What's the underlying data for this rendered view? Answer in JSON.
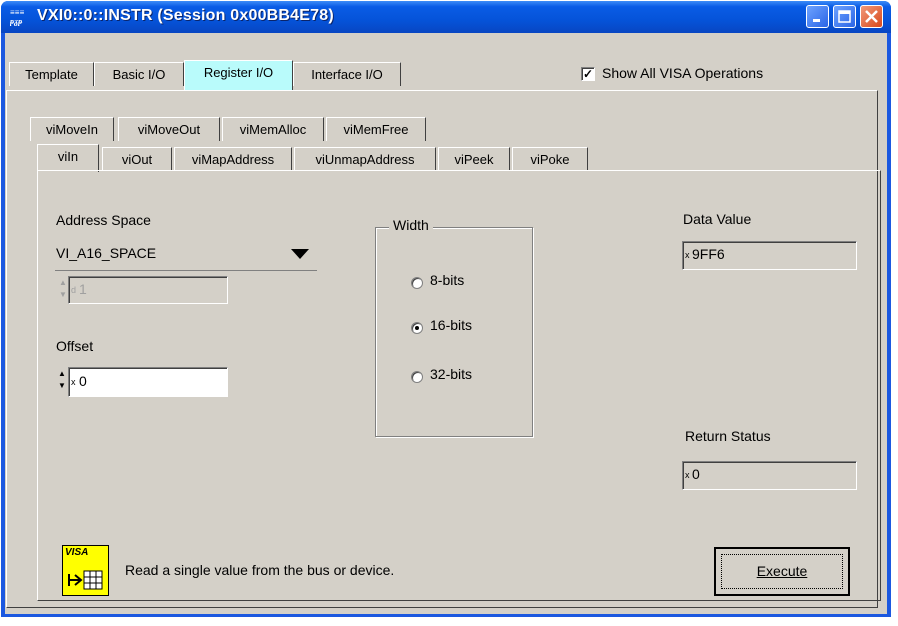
{
  "window": {
    "title": "VXI0::0::INSTR (Session 0x00BB4E78)"
  },
  "tabs": {
    "top": [
      "Template",
      "Basic I/O",
      "Register I/O",
      "Interface I/O"
    ],
    "active_top": "Register I/O",
    "sub_row1": [
      "viMoveIn",
      "viMoveOut",
      "viMemAlloc",
      "viMemFree"
    ],
    "sub_row2": [
      "viIn",
      "viOut",
      "viMapAddress",
      "viUnmapAddress",
      "viPeek",
      "viPoke"
    ],
    "active_sub": "viIn"
  },
  "show_all": {
    "label": "Show All VISA Operations",
    "checked": true
  },
  "address_space": {
    "label": "Address Space",
    "value": "VI_A16_SPACE"
  },
  "width_field": {
    "prefix": "d",
    "value": "1"
  },
  "offset": {
    "label": "Offset",
    "prefix": "x",
    "value": "0"
  },
  "width_group": {
    "label": "Width",
    "options": [
      "8-bits",
      "16-bits",
      "32-bits"
    ],
    "selected": "16-bits"
  },
  "data_value": {
    "label": "Data Value",
    "prefix": "x",
    "value": "9FF6"
  },
  "return_status": {
    "label": "Return Status",
    "prefix": "x",
    "value": "0"
  },
  "description": "Read a single value from the bus or device.",
  "visa_logo": "VISA",
  "execute": {
    "label": "Execute"
  }
}
